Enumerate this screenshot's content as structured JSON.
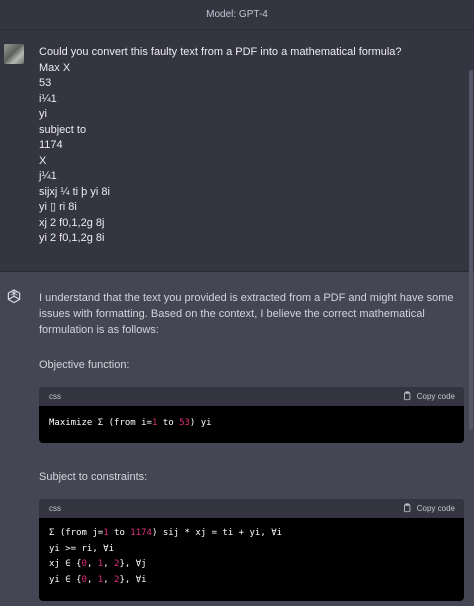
{
  "header": {
    "title": "Model: GPT-4"
  },
  "user_message": {
    "lines": [
      "Could you convert this faulty text from a PDF into a mathematical formula?",
      "Max X",
      "53",
      "i¼1",
      "yi",
      "subject to",
      "1174",
      "X",
      "j¼1",
      "sijxj ¼ ti þ yi 8i",
      "yi ▯ ri 8i",
      "xj 2 f0,1,2g 8j",
      "yi 2 f0,1,2g 8i"
    ]
  },
  "assistant_message": {
    "intro": "I understand that the text you provided is extracted from a PDF and might have some issues with formatting. Based on the context, I believe the correct mathematical formulation is as follows:",
    "objective_heading": "Objective function:",
    "constraints_heading": "Subject to constraints:",
    "code_blocks": [
      {
        "language": "css",
        "copy_label": "Copy code",
        "lines": [
          [
            {
              "t": "Maximize Σ (from i=",
              "c": "plain"
            },
            {
              "t": "1",
              "c": "num"
            },
            {
              "t": " to ",
              "c": "plain"
            },
            {
              "t": "53",
              "c": "num"
            },
            {
              "t": ") yi",
              "c": "plain"
            }
          ]
        ]
      },
      {
        "language": "css",
        "copy_label": "Copy code",
        "lines": [
          [
            {
              "t": "Σ (from j=",
              "c": "plain"
            },
            {
              "t": "1",
              "c": "num"
            },
            {
              "t": " to ",
              "c": "plain"
            },
            {
              "t": "1174",
              "c": "num"
            },
            {
              "t": ") sij * xj = ti + yi, ∀i",
              "c": "plain"
            }
          ],
          [
            {
              "t": "yi >= ri, ∀i",
              "c": "plain"
            }
          ],
          [
            {
              "t": "xj ∈ {",
              "c": "plain"
            },
            {
              "t": "0",
              "c": "num"
            },
            {
              "t": ", ",
              "c": "plain"
            },
            {
              "t": "1",
              "c": "num"
            },
            {
              "t": ", ",
              "c": "plain"
            },
            {
              "t": "2",
              "c": "num"
            },
            {
              "t": "}, ∀j",
              "c": "plain"
            }
          ],
          [
            {
              "t": "yi ∈ {",
              "c": "plain"
            },
            {
              "t": "0",
              "c": "num"
            },
            {
              "t": ", ",
              "c": "plain"
            },
            {
              "t": "1",
              "c": "num"
            },
            {
              "t": ", ",
              "c": "plain"
            },
            {
              "t": "2",
              "c": "num"
            },
            {
              "t": "}, ∀i",
              "c": "plain"
            }
          ]
        ]
      }
    ]
  },
  "icons": {
    "user_avatar": "user-avatar-image",
    "assistant_avatar": "openai-logo-icon",
    "copy": "clipboard-icon"
  },
  "colors": {
    "background": "#343541",
    "assistant_background": "#444654",
    "code_background": "#000000",
    "code_number": "#df3079"
  }
}
